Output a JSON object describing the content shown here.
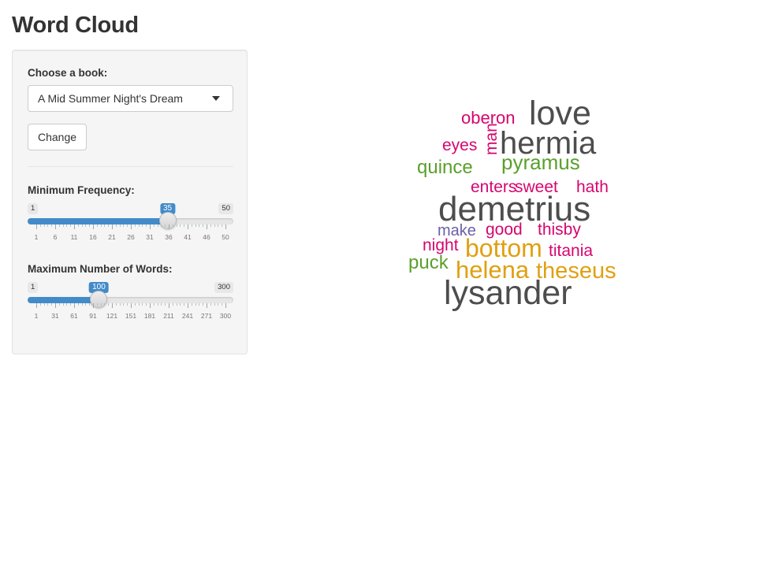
{
  "page": {
    "title": "Word Cloud"
  },
  "sidebar": {
    "book_label": "Choose a book:",
    "book_selected": "A Mid Summer Night's Dream",
    "change_button": "Change",
    "min_freq": {
      "label": "Minimum Frequency:",
      "min": 1,
      "max": 50,
      "value": 35,
      "min_label": "1",
      "max_label": "50",
      "value_label": "35",
      "ticks": [
        "1",
        "6",
        "11",
        "16",
        "21",
        "26",
        "31",
        "36",
        "41",
        "46",
        "50"
      ]
    },
    "max_words": {
      "label": "Maximum Number of Words:",
      "min": 1,
      "max": 300,
      "value": 100,
      "min_label": "1",
      "max_label": "300",
      "value_label": "100",
      "ticks": [
        "1",
        "31",
        "61",
        "91",
        "121",
        "151",
        "181",
        "211",
        "241",
        "271",
        "300"
      ]
    }
  },
  "cloud": {
    "colors": {
      "dark": "#4d4d4d",
      "magenta": "#d6056f",
      "green": "#5aa02c",
      "orange": "#e0a012",
      "purple": "#6a5fa8"
    },
    "words": [
      {
        "text": "oberon",
        "color": "#d6056f"
      },
      {
        "text": "love",
        "color": "#4d4d4d"
      },
      {
        "text": "eyes",
        "color": "#d6056f"
      },
      {
        "text": "man",
        "color": "#d6056f"
      },
      {
        "text": "hermia",
        "color": "#4d4d4d"
      },
      {
        "text": "quince",
        "color": "#5aa02c"
      },
      {
        "text": "pyramus",
        "color": "#5aa02c"
      },
      {
        "text": "enters",
        "color": "#d6056f"
      },
      {
        "text": "sweet",
        "color": "#d6056f"
      },
      {
        "text": "hath",
        "color": "#d6056f"
      },
      {
        "text": "demetrius",
        "color": "#4d4d4d"
      },
      {
        "text": "make",
        "color": "#6a5fa8"
      },
      {
        "text": "good",
        "color": "#d6056f"
      },
      {
        "text": "thisby",
        "color": "#d6056f"
      },
      {
        "text": "night",
        "color": "#d6056f"
      },
      {
        "text": "bottom",
        "color": "#e0a012"
      },
      {
        "text": "titania",
        "color": "#d6056f"
      },
      {
        "text": "puck",
        "color": "#5aa02c"
      },
      {
        "text": "helena",
        "color": "#e0a012"
      },
      {
        "text": "theseus",
        "color": "#e0a012"
      },
      {
        "text": "lysander",
        "color": "#4d4d4d"
      }
    ]
  }
}
